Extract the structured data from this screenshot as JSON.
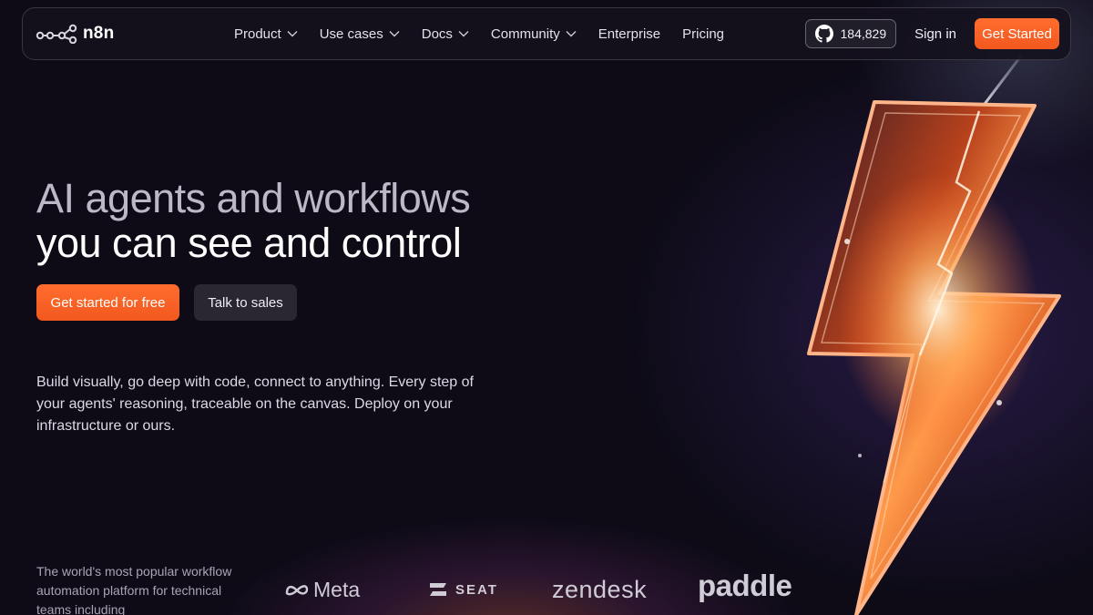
{
  "nav": {
    "logo_text": "n8n",
    "items": [
      {
        "label": "Product",
        "has_dropdown": true
      },
      {
        "label": "Use cases",
        "has_dropdown": true
      },
      {
        "label": "Docs",
        "has_dropdown": true
      },
      {
        "label": "Community",
        "has_dropdown": true
      },
      {
        "label": "Enterprise",
        "has_dropdown": false
      },
      {
        "label": "Pricing",
        "has_dropdown": false
      }
    ],
    "github_stars": "184,829",
    "github_icon": "github-icon",
    "sign_in": "Sign in",
    "get_started": "Get Started"
  },
  "hero": {
    "title_line1": "AI agents and workflows",
    "title_line2": "you can see and control",
    "cta_primary": "Get started for free",
    "cta_secondary": "Talk to sales",
    "description": "Build visually, go deep with code, connect to anything. Every step of your agents' reasoning, traceable on the canvas. Deploy on your infrastructure or ours."
  },
  "trusted": {
    "text": "The world's most popular workflow automation platform for technical teams including",
    "logos": [
      "Meta",
      "SEAT",
      "zendesk",
      "paddle"
    ]
  },
  "colors": {
    "background": "#0e0b17",
    "accent": "#ff6d2e",
    "secondary_button": "#2a2733"
  }
}
